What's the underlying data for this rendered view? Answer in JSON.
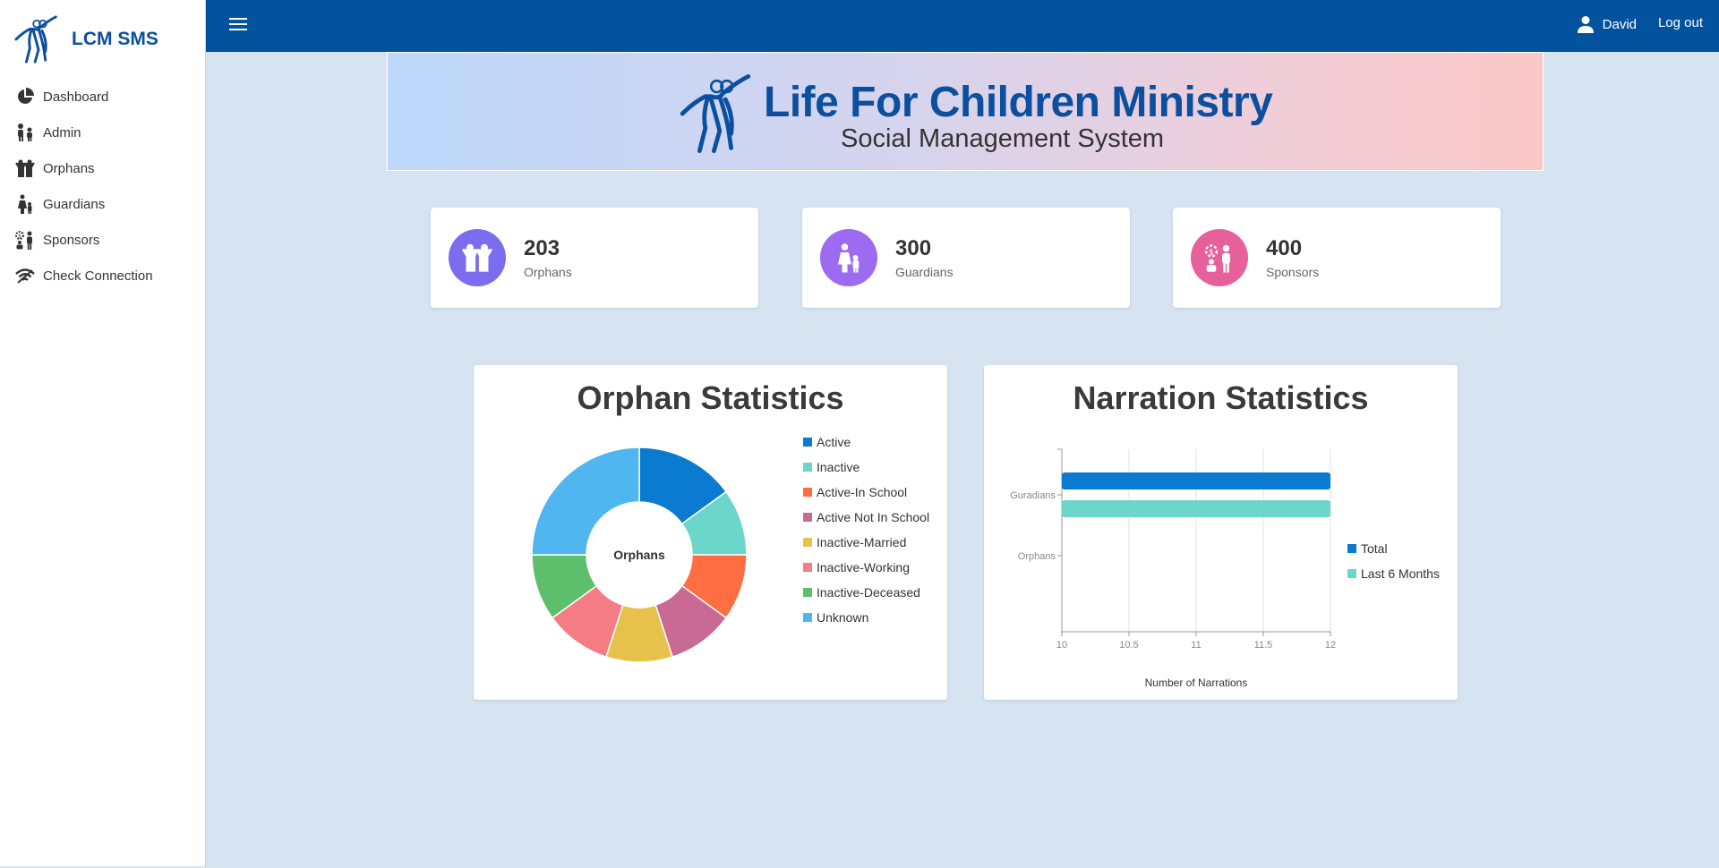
{
  "sidebar": {
    "brand": "LCM SMS",
    "items": [
      {
        "label": "Dashboard",
        "icon": "pie-chart-icon"
      },
      {
        "label": "Admin",
        "icon": "admin-people-icon"
      },
      {
        "label": "Orphans",
        "icon": "children-icon"
      },
      {
        "label": "Guardians",
        "icon": "guardian-icon"
      },
      {
        "label": "Sponsors",
        "icon": "sponsor-icon"
      },
      {
        "label": "Check Connection",
        "icon": "wifi-icon"
      }
    ]
  },
  "topbar": {
    "user_name": "David",
    "logout_label": "Log out"
  },
  "banner": {
    "title": "Life For Children Ministry",
    "subtitle": "Social Management System"
  },
  "stats": [
    {
      "value": "203",
      "label": "Orphans",
      "color": "#7b6cf0",
      "icon": "children-icon"
    },
    {
      "value": "300",
      "label": "Guardians",
      "color": "#9d6bf0",
      "icon": "guardian-icon"
    },
    {
      "value": "400",
      "label": "Sponsors",
      "color": "#e6609c",
      "icon": "sponsor-icon"
    }
  ],
  "orphan_chart": {
    "title": "Orphan Statistics",
    "center_label": "Orphans"
  },
  "narration_chart": {
    "title": "Narration Statistics",
    "xlabel": "Number of Narrations"
  },
  "chart_data": [
    {
      "type": "pie",
      "title": "Orphan Statistics",
      "center_label": "Orphans",
      "legend_position": "right",
      "labels": [
        "Active",
        "Inactive",
        "Active-In School",
        "Active Not In School",
        "Inactive-Married",
        "Inactive-Working",
        "Inactive-Deceased",
        "Unknown"
      ],
      "values": [
        15,
        10,
        10,
        10,
        10,
        10,
        10,
        25
      ],
      "colors": [
        "#0a7bd1",
        "#6dd6cb",
        "#ff6e42",
        "#c86a93",
        "#e6c24d",
        "#f57b85",
        "#5dbf6b",
        "#4fb6ef"
      ]
    },
    {
      "type": "bar",
      "orientation": "horizontal",
      "title": "Narration Statistics",
      "categories": [
        "Guradians",
        "Orphans"
      ],
      "series": [
        {
          "name": "Total",
          "values": [
            12,
            0
          ],
          "color": "#0a7bd1"
        },
        {
          "name": "Last 6 Months",
          "values": [
            12,
            0
          ],
          "color": "#6dd6cb"
        }
      ],
      "xlabel": "Number of Narrations",
      "xlim": [
        10,
        12
      ],
      "xticks": [
        "10",
        "10.5",
        "11",
        "11.5",
        "12"
      ],
      "grid": true,
      "legend_position": "right"
    }
  ]
}
